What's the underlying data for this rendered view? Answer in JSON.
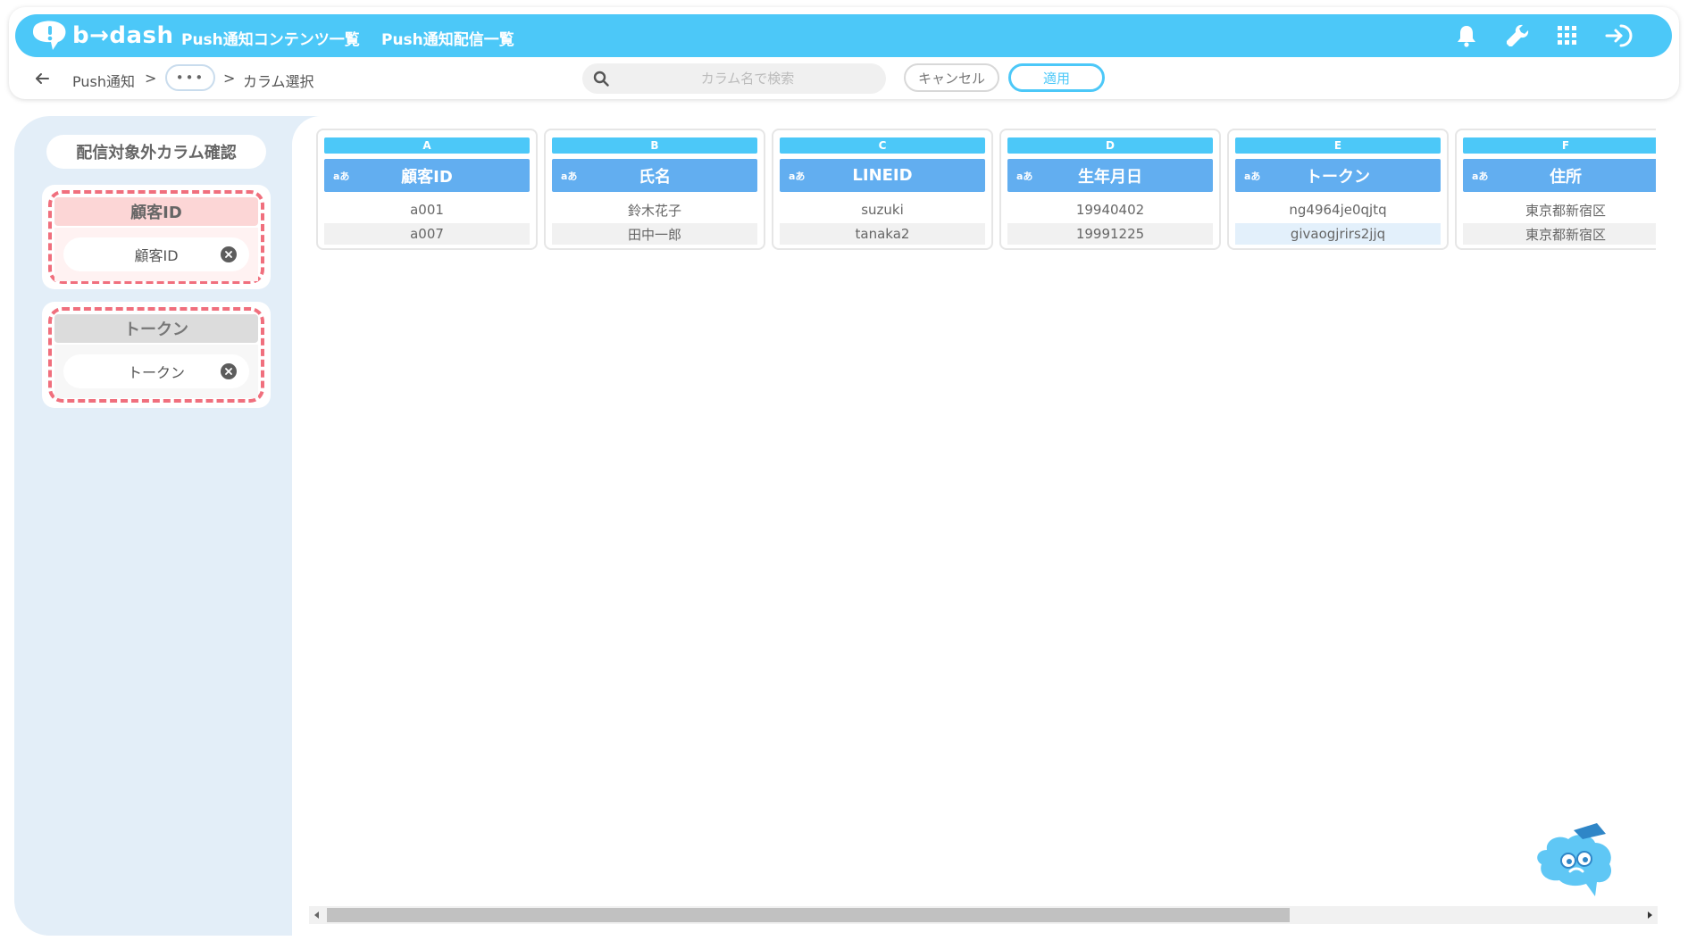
{
  "header": {
    "logo_text": "b→dash",
    "nav": [
      {
        "label": "Push通知コンテンツ一覧"
      },
      {
        "label": "Push通知配信一覧"
      }
    ],
    "icons": [
      "bell-icon",
      "wrench-icon",
      "apps-grid-icon",
      "logout-icon"
    ],
    "accent": "#4cc8f8"
  },
  "toolbar": {
    "breadcrumb": {
      "root": "Push通知",
      "sep1": ">",
      "more": "•••",
      "sep2": ">",
      "current": "カラム選択"
    },
    "search": {
      "placeholder": "カラム名で検索",
      "value": ""
    },
    "cancel_label": "キャンセル",
    "apply_label": "適用"
  },
  "left_panel": {
    "title": "配信対象外カラム確認",
    "groups": [
      {
        "header": "顧客ID",
        "chip": "顧客ID",
        "style": "pink"
      },
      {
        "header": "トークン",
        "chip": "トークン",
        "style": "gray"
      }
    ],
    "highlight_color": "#f06f7d"
  },
  "columns": [
    {
      "letter": "A",
      "type": "aあ",
      "name": "顧客ID",
      "rows": [
        "a001",
        "a007"
      ]
    },
    {
      "letter": "B",
      "type": "aあ",
      "name": "氏名",
      "rows": [
        "鈴木花子",
        "田中一郎"
      ]
    },
    {
      "letter": "C",
      "type": "aあ",
      "name": "LINEID",
      "rows": [
        "suzuki",
        "tanaka2"
      ]
    },
    {
      "letter": "D",
      "type": "aあ",
      "name": "生年月日",
      "rows": [
        "19940402",
        "19991225"
      ]
    },
    {
      "letter": "E",
      "type": "aあ",
      "name": "トークン",
      "rows": [
        "ng4964je0qjtq",
        "givaogjrirs2jjq"
      ]
    },
    {
      "letter": "F",
      "type": "aあ",
      "name": "住所",
      "rows": [
        "東京都新宿区",
        "東京都新宿区"
      ]
    }
  ],
  "scrollbar": {
    "left_arrow": "◂",
    "right_arrow": "▸"
  }
}
